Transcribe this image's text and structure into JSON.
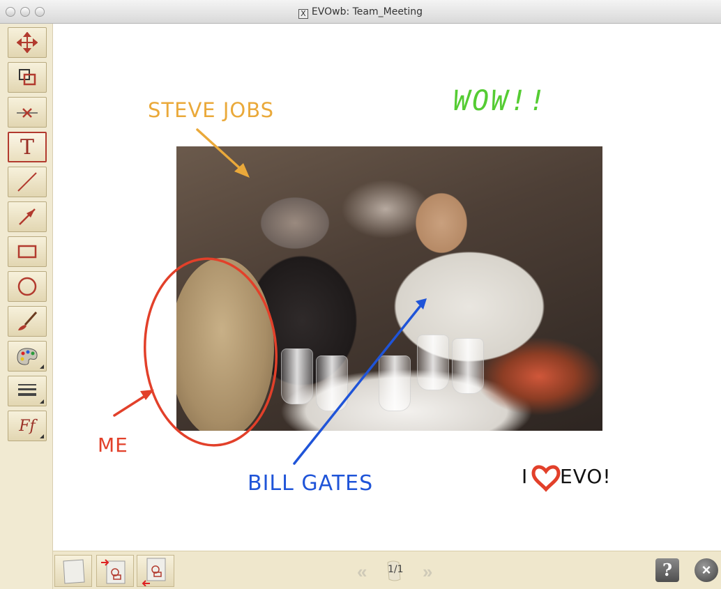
{
  "window": {
    "title": "EVOwb: Team_Meeting"
  },
  "toolbar": {
    "tools": [
      {
        "name": "move-tool",
        "icon": "move-arrows-icon"
      },
      {
        "name": "copy-tool",
        "icon": "copy-squares-icon"
      },
      {
        "name": "delete-tool",
        "icon": "delete-cross-icon"
      },
      {
        "name": "text-tool",
        "icon": "text-t-icon",
        "label": "T",
        "active": true
      },
      {
        "name": "line-tool",
        "icon": "line-icon"
      },
      {
        "name": "arrow-tool",
        "icon": "arrow-icon"
      },
      {
        "name": "rectangle-tool",
        "icon": "rectangle-icon"
      },
      {
        "name": "ellipse-tool",
        "icon": "ellipse-icon"
      },
      {
        "name": "brush-tool",
        "icon": "brush-icon"
      },
      {
        "name": "color-tool",
        "icon": "palette-icon"
      },
      {
        "name": "line-width-tool",
        "icon": "line-width-icon"
      },
      {
        "name": "font-tool",
        "icon": "font-icon",
        "label": "Ff"
      }
    ]
  },
  "annotations": {
    "steve_jobs": "STEVE JOBS",
    "wow": "WOW!!",
    "me": "ME",
    "bill_gates": "BILL GATES",
    "i_love_evo_prefix": "I",
    "i_love_evo_suffix": "EVO!"
  },
  "colors": {
    "steve_jobs": "#eaa93a",
    "wow": "#55cc33",
    "me": "#e2402a",
    "bill_gates": "#1f54d8",
    "evo_text": "#111111",
    "heart": "#e2402a"
  },
  "bottombar": {
    "page_indicator": "1/1",
    "prev_label": "«",
    "next_label": "»",
    "help_label": "?",
    "close_label": "×"
  }
}
